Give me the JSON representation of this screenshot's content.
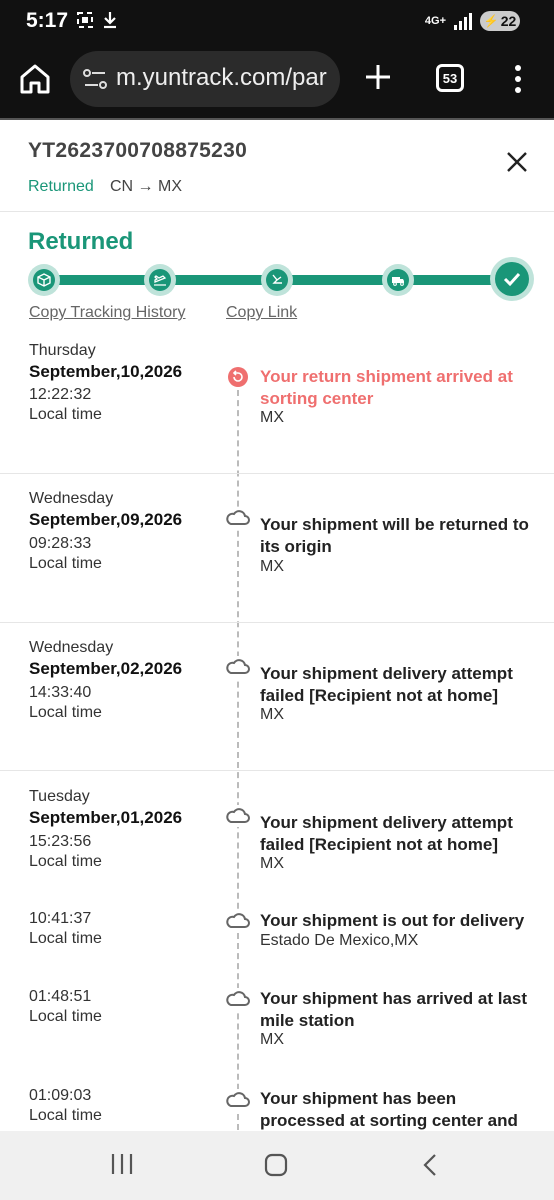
{
  "status_bar": {
    "time": "5:17",
    "network": "4G+",
    "battery": "22"
  },
  "browser": {
    "url": "m.yuntrack.com/par",
    "tab_count": "53"
  },
  "header": {
    "tracking_number": "YT2623700708875230",
    "status": "Returned",
    "route": "CN → MX"
  },
  "summary": {
    "status": "Returned",
    "copy_history_label": "Copy Tracking History",
    "copy_link_label": "Copy Link",
    "progress_steps": [
      "package-icon",
      "plane-icon",
      "customs-icon",
      "truck-icon",
      "check-icon"
    ],
    "completed_fraction": 1.0
  },
  "events": [
    {
      "day": "Thursday",
      "date": "September,10,2026",
      "time": "12:22:32",
      "tz": "Local time",
      "title": "Your return shipment arrived at sorting center",
      "location": "MX",
      "icon": "return-icon",
      "highlight": true
    },
    {
      "day": "Wednesday",
      "date": "September,09,2026",
      "time": "09:28:33",
      "tz": "Local time",
      "title": "Your shipment will be returned to its origin",
      "location": "MX",
      "icon": "cloud-icon"
    },
    {
      "day": "Wednesday",
      "date": "September,02,2026",
      "time": "14:33:40",
      "tz": "Local time",
      "title": "Your shipment delivery attempt failed [Recipient not at home]",
      "location": "MX",
      "icon": "cloud-icon"
    },
    {
      "day": "Tuesday",
      "date": "September,01,2026",
      "time": "15:23:56",
      "tz": "Local time",
      "title": "Your shipment delivery attempt failed [Recipient not at home]",
      "location": "MX",
      "icon": "cloud-icon"
    },
    {
      "time": "10:41:37",
      "tz": "Local time",
      "title": "Your shipment is out for delivery",
      "location": "Estado De Mexico,MX",
      "icon": "cloud-icon"
    },
    {
      "time": "01:48:51",
      "tz": "Local time",
      "title": "Your shipment has arrived at last mile station",
      "location": "MX",
      "icon": "cloud-icon"
    },
    {
      "time": "01:09:03",
      "tz": "Local time",
      "title": "Your shipment has been processed at sorting center and",
      "icon": "cloud-icon"
    }
  ],
  "colors": {
    "accent": "#1a9678",
    "accent_light": "#bfe3da",
    "alert": "#ef6f6f"
  }
}
